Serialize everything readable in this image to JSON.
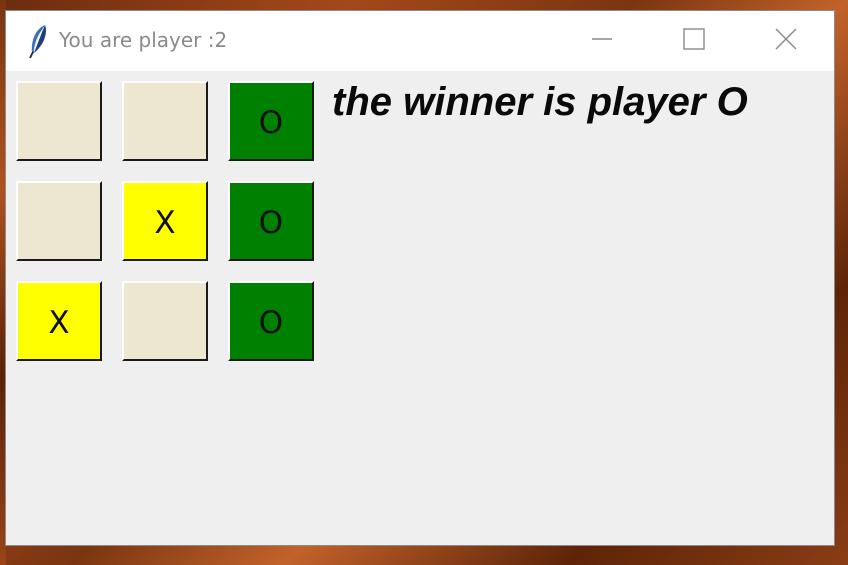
{
  "window": {
    "title": "You are player :2",
    "icon": "feather-icon"
  },
  "titlebar_controls": {
    "minimize_icon": "minimize-icon",
    "maximize_icon": "maximize-icon",
    "close_icon": "close-icon"
  },
  "board": {
    "rows": [
      [
        {
          "mark": "",
          "color": "#ede7d1"
        },
        {
          "mark": "",
          "color": "#ede7d1"
        },
        {
          "mark": "O",
          "color": "#008000"
        }
      ],
      [
        {
          "mark": "",
          "color": "#ede7d1"
        },
        {
          "mark": "X",
          "color": "#ffff00"
        },
        {
          "mark": "O",
          "color": "#008000"
        }
      ],
      [
        {
          "mark": "X",
          "color": "#ffff00"
        },
        {
          "mark": "",
          "color": "#ede7d1"
        },
        {
          "mark": "O",
          "color": "#008000"
        }
      ]
    ]
  },
  "status": {
    "winner_text": "the winner is player O"
  },
  "colors": {
    "empty_cell": "#ede7d1",
    "x_cell": "#ffff00",
    "o_cell": "#008000",
    "window_bg": "#f0f0f0"
  }
}
